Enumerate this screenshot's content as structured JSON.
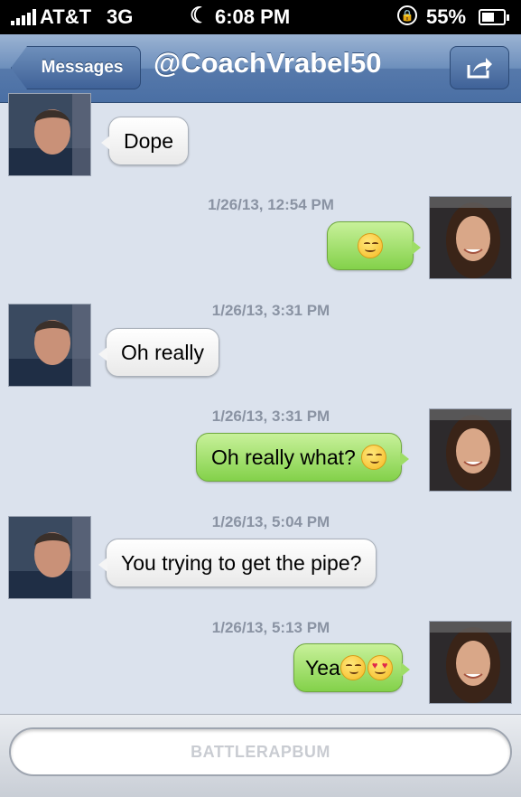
{
  "status_bar": {
    "carrier": "AT&T",
    "network": "3G",
    "time": "6:08 PM",
    "battery_percent": "55%"
  },
  "nav": {
    "back_label": "Messages",
    "title": "@CoachVrabel50"
  },
  "messages": [
    {
      "sender": "them",
      "text": "Dope"
    },
    {
      "timestamp": "1/26/13, 12:54 PM",
      "sender": "me",
      "text": "",
      "emoji": [
        "smile"
      ]
    },
    {
      "timestamp": "1/26/13, 3:31 PM",
      "sender": "them",
      "text": "Oh really"
    },
    {
      "timestamp": "1/26/13, 3:31 PM",
      "sender": "me",
      "text": "Oh really what?",
      "emoji": [
        "smirk"
      ]
    },
    {
      "timestamp": "1/26/13, 5:04 PM",
      "sender": "them",
      "text": "You trying to get the pipe?"
    },
    {
      "timestamp": "1/26/13, 5:13 PM",
      "sender": "me",
      "text": "Yea",
      "emoji": [
        "smirk",
        "heart-eyes"
      ]
    }
  ],
  "composer": {
    "placeholder": "BATTLERAPBUM"
  }
}
